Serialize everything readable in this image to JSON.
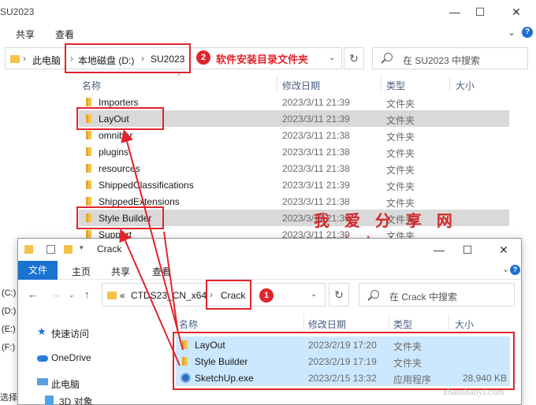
{
  "back": {
    "title": "SU2023",
    "controls": {
      "minimize": "—",
      "maximize": "☐",
      "close": "✕"
    },
    "ribbon": {
      "share": "共享",
      "view": "查看"
    },
    "breadcrumb": [
      "此电脑",
      "本地磁盘 (D:)",
      "SU2023"
    ],
    "annotation_label": "软件安装目录文件夹",
    "annotation_number": "2",
    "search_placeholder": "在 SU2023 中搜索",
    "columns": {
      "name": "名称",
      "date": "修改日期",
      "type": "类型",
      "size": "大小"
    },
    "rows": [
      {
        "name": "Importers",
        "date": "2023/3/11 21:39",
        "type": "文件夹"
      },
      {
        "name": "LayOut",
        "date": "2023/3/11 21:39",
        "type": "文件夹"
      },
      {
        "name": "omnibar",
        "date": "2023/3/11 21:38",
        "type": "文件夹"
      },
      {
        "name": "plugins",
        "date": "2023/3/11 21:38",
        "type": "文件夹"
      },
      {
        "name": "resources",
        "date": "2023/3/11 21:38",
        "type": "文件夹"
      },
      {
        "name": "ShippedClassifications",
        "date": "2023/3/11 21:39",
        "type": "文件夹"
      },
      {
        "name": "ShippedExtensions",
        "date": "2023/3/11 21:38",
        "type": "文件夹"
      },
      {
        "name": "Style Builder",
        "date": "2023/3/11 21:39",
        "type": "文件夹"
      },
      {
        "name": "Support",
        "date": "2023/3/11 21:39",
        "type": "文件夹"
      }
    ],
    "drives": [
      "(C:)",
      "(D:)",
      "(E:)",
      "(F:)"
    ],
    "status": "选择"
  },
  "watermark": {
    "chinese": "我 爱 分 享 网",
    "url": "www.zhanshaoyi.com",
    "footer": "zhanshaoyi.com"
  },
  "front": {
    "title": "Crack",
    "ribbon": {
      "file": "文件",
      "home": "主页",
      "share": "共享",
      "view": "查看"
    },
    "breadcrumb": [
      "«",
      "CTDS23_CN_x64",
      "Crack"
    ],
    "annotation_number": "1",
    "search_placeholder": "在 Crack 中搜索",
    "sidebar": [
      "快速访问",
      "OneDrive",
      "此电脑",
      "3D 对象"
    ],
    "columns": {
      "name": "名称",
      "date": "修改日期",
      "type": "类型",
      "size": "大小"
    },
    "rows": [
      {
        "name": "LayOut",
        "date": "2023/2/19 17:20",
        "type": "文件夹",
        "size": "",
        "icon": "folder-icon"
      },
      {
        "name": "Style Builder",
        "date": "2023/2/19 17:19",
        "type": "文件夹",
        "size": "",
        "icon": "folder-icon"
      },
      {
        "name": "SketchUp.exe",
        "date": "2023/2/15 13:32",
        "type": "应用程序",
        "size": "28,940 KB",
        "icon": "exe-icon"
      }
    ]
  },
  "colors": {
    "accent": "#1a73d1",
    "annotation_red": "#e0242c",
    "selection": "#cce8ff",
    "folder": "#f5c24c"
  }
}
